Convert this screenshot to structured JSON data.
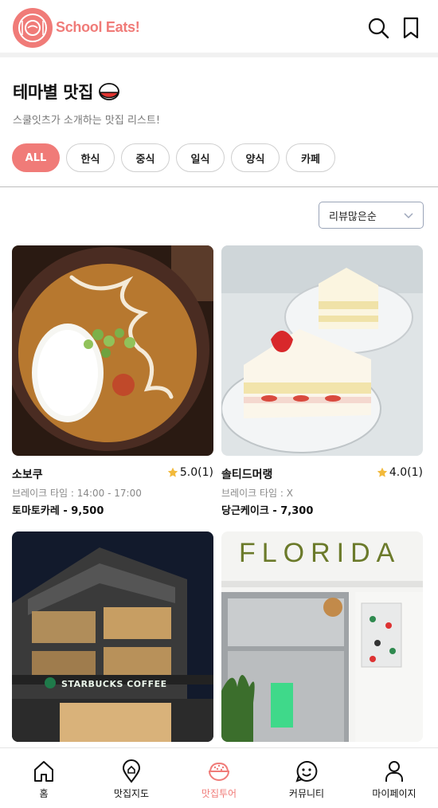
{
  "header": {
    "brand": "School Eats!",
    "search_icon": "search-icon",
    "bookmark_icon": "bookmark-icon"
  },
  "section": {
    "title": "테마별 맛집",
    "subtitle": "스쿨잇츠가 소개하는 맛집 리스트!"
  },
  "categories": [
    "ALL",
    "한식",
    "중식",
    "일식",
    "양식",
    "카페"
  ],
  "active_category": "ALL",
  "sort": {
    "selected": "리뷰많은순"
  },
  "restaurants": [
    {
      "name": "소보쿠",
      "rating": "5.0(1)",
      "break_time": "브레이크 타임 : 14:00 - 17:00",
      "menu": "토마토카레 - 9,500"
    },
    {
      "name": "솔티드머랭",
      "rating": "4.0(1)",
      "break_time": "브레이크 타임 : X",
      "menu": "당근케이크 - 7,300"
    },
    {
      "name": "",
      "rating": "",
      "break_time": "",
      "menu": "",
      "sign": "STARBUCKS COFFEE"
    },
    {
      "name": "",
      "rating": "",
      "break_time": "",
      "menu": "",
      "sign": "FLORIDA"
    }
  ],
  "bottom_nav": [
    {
      "label": "홈",
      "icon": "home-icon"
    },
    {
      "label": "맛집지도",
      "icon": "map-pin-icon"
    },
    {
      "label": "맛집투어",
      "icon": "rice-bowl-icon",
      "active": true
    },
    {
      "label": "커뮤니티",
      "icon": "smile-icon"
    },
    {
      "label": "마이페이지",
      "icon": "user-icon"
    }
  ],
  "colors": {
    "accent": "#f07b78",
    "star": "#f2b93b"
  }
}
